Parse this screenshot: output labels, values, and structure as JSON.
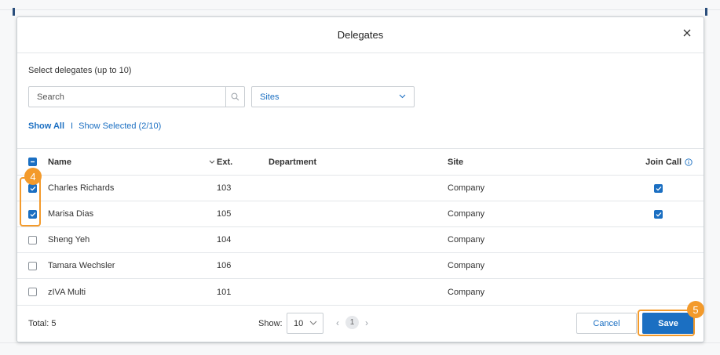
{
  "dialog": {
    "title": "Delegates",
    "subtitle": "Select delegates (up to 10)"
  },
  "search": {
    "placeholder": "Search"
  },
  "sites_dropdown": {
    "value": "Sites"
  },
  "filters": {
    "show_all": "Show All",
    "separator": "I",
    "show_selected": "Show Selected (2/10)"
  },
  "table": {
    "headers": {
      "name": "Name",
      "ext": "Ext.",
      "department": "Department",
      "site": "Site",
      "join_call": "Join Call"
    },
    "rows": [
      {
        "name": "Charles Richards",
        "ext": "103",
        "department": "",
        "site": "Company",
        "selected": true,
        "join_call": true
      },
      {
        "name": "Marisa Dias",
        "ext": "105",
        "department": "",
        "site": "Company",
        "selected": true,
        "join_call": true
      },
      {
        "name": "Sheng Yeh",
        "ext": "104",
        "department": "",
        "site": "Company",
        "selected": false,
        "join_call": false
      },
      {
        "name": "Tamara Wechsler",
        "ext": "106",
        "department": "",
        "site": "Company",
        "selected": false,
        "join_call": false
      },
      {
        "name": "zIVA Multi",
        "ext": "101",
        "department": "",
        "site": "Company",
        "selected": false,
        "join_call": false
      }
    ]
  },
  "footer": {
    "total": "Total: 5",
    "show_label": "Show:",
    "per_page": "10",
    "page": "1",
    "cancel": "Cancel",
    "save": "Save"
  },
  "callouts": {
    "rows": "4",
    "save": "5"
  },
  "colors": {
    "accent": "#1b6fc2",
    "callout": "#f39a2b"
  }
}
